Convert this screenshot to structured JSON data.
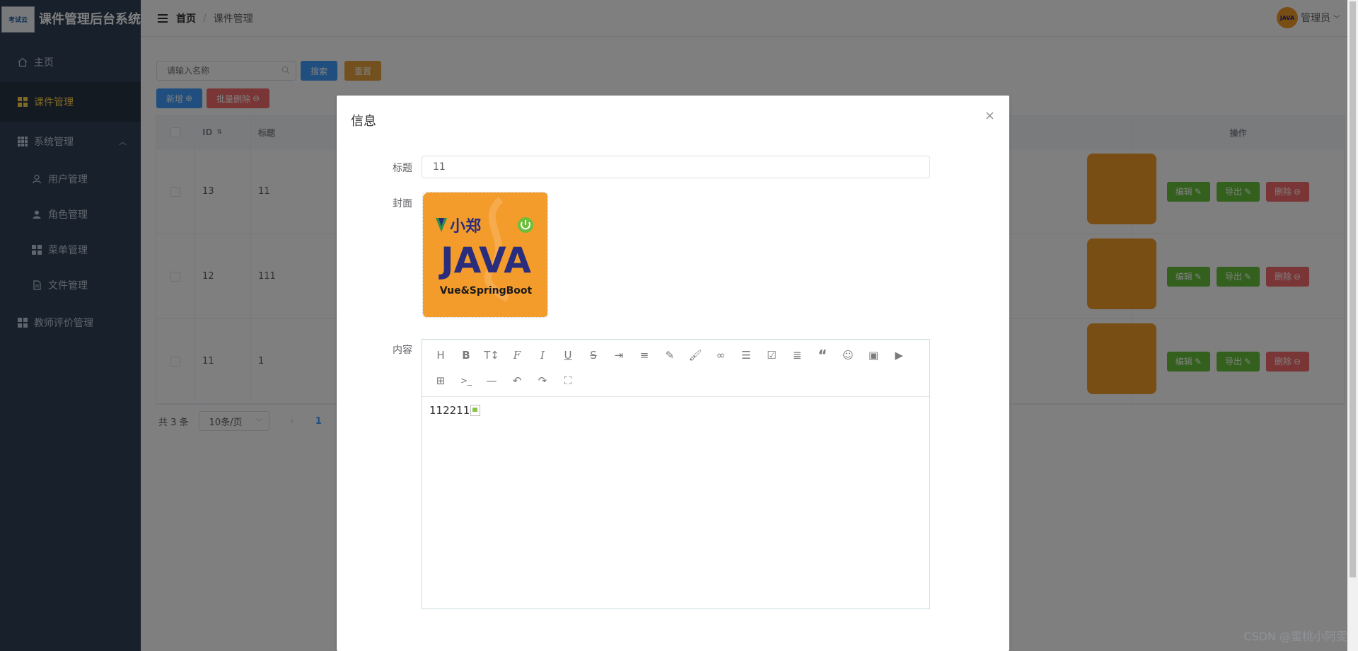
{
  "app": {
    "title": "课件管理后台系统",
    "logo_text": "考试云"
  },
  "sidebar": {
    "items": [
      {
        "label": "主页",
        "icon": "home-icon"
      },
      {
        "label": "课件管理",
        "icon": "grid-icon"
      },
      {
        "label": "系统管理",
        "icon": "grid-icon"
      },
      {
        "label": "用户管理",
        "icon": "user-icon"
      },
      {
        "label": "角色管理",
        "icon": "user-filled-icon"
      },
      {
        "label": "菜单管理",
        "icon": "grid-icon"
      },
      {
        "label": "文件管理",
        "icon": "document-icon"
      },
      {
        "label": "教师评价管理",
        "icon": "grid-icon"
      }
    ],
    "active_color": "#ffd04b"
  },
  "header": {
    "breadcrumb": {
      "home": "首页",
      "separator": "/",
      "current": "课件管理"
    },
    "user": {
      "name": "管理员",
      "avatar_text": "JAVA"
    }
  },
  "toolbar": {
    "search_placeholder": "请输入名称",
    "search_label": "搜索",
    "reset_label": "重置",
    "add_label": "新增",
    "batch_delete_label": "批量删除"
  },
  "table": {
    "columns": {
      "id": "ID",
      "title": "标题",
      "ops": "操作"
    },
    "rows": [
      {
        "id": "13",
        "title": "11"
      },
      {
        "id": "12",
        "title": "111"
      },
      {
        "id": "11",
        "title": "1"
      }
    ],
    "edit_label": "编辑",
    "export_label": "导出",
    "delete_label": "删除"
  },
  "pagination": {
    "total": "共 3 条",
    "page_size": "10条/页",
    "current_page": "1"
  },
  "dialog": {
    "title": "信息",
    "close": "×",
    "fields": {
      "title_label": "标题",
      "title_value": "11",
      "cover_label": "封面",
      "content_label": "内容"
    },
    "cover": {
      "top_text": "小郑",
      "main_text": "JAVA",
      "sub_text": "Vue&SpringBoot"
    },
    "editor": {
      "tools": [
        "heading-icon",
        "bold-icon",
        "font-size-icon",
        "font-family-icon",
        "italic-icon",
        "underline-icon",
        "strikethrough-icon",
        "indent-icon",
        "align-icon",
        "foreground-color-icon",
        "background-color-icon",
        "link-icon",
        "bullet-list-icon",
        "todo-icon",
        "justify-icon",
        "quote-icon",
        "emoticon-icon",
        "image-icon",
        "video-icon",
        "table-icon",
        "code-icon",
        "divider-icon",
        "undo-icon",
        "redo-icon",
        "fullscreen-icon"
      ],
      "content": "112211"
    }
  },
  "watermark": "CSDN @蜜桃小阿雯",
  "colors": {
    "sidebar": "#304156",
    "primary": "#409eff",
    "success": "#67c23a",
    "warning": "#e6a23c",
    "danger": "#f56c6c",
    "cover_bg": "#f39c2b"
  }
}
